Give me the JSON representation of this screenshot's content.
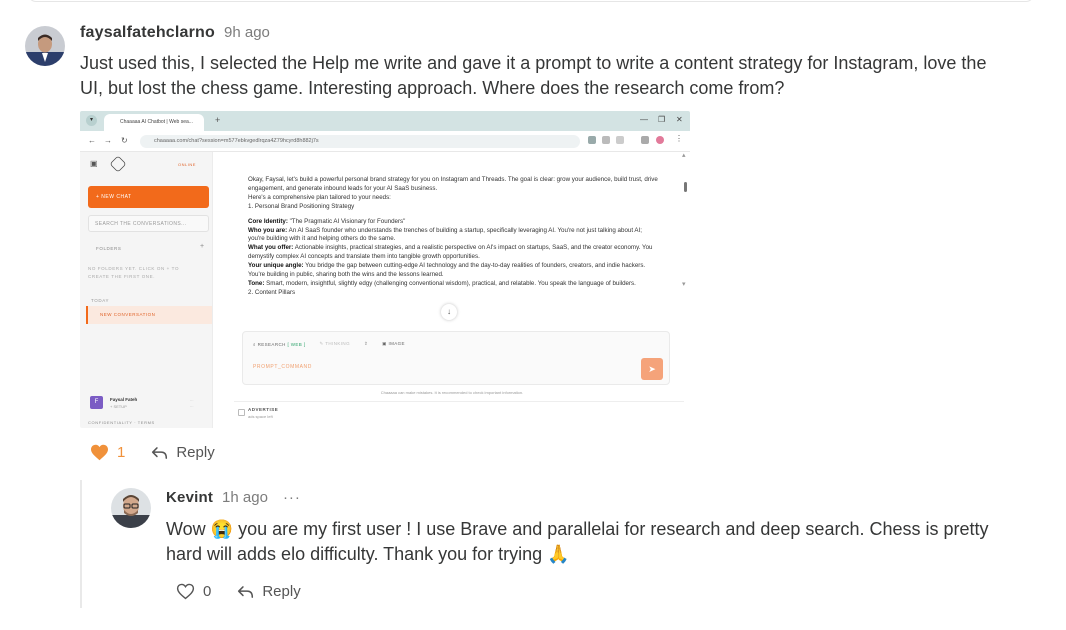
{
  "comment1": {
    "author": "faysalfatehclarno",
    "time": "9h ago",
    "text_line1": "Just used this, I selected the Help me write and gave it a prompt to write a content strategy for Instagram, love the",
    "text_line2": "UI, but lost the chess game. Interesting approach. Where does the research come from?",
    "like_count": "1",
    "reply_label": "Reply"
  },
  "attachment": {
    "tab_title": "Chaaaaa AI Chatbot | Web sea...",
    "url": "chaaaaa.com/chat?session=m577ebkvgedlrqza4Z79hcyrd8h882j7s",
    "sidebar": {
      "online": "ONLINE",
      "new_chat": "+  NEW CHAT",
      "search_placeholder": "SEARCH THE CONVERSATIONS...",
      "folders": "FOLDERS",
      "no_folders": "NO FOLDERS YET. CLICK ON + TO CREATE THE FIRST ONE.",
      "today": "TODAY",
      "new_conversation": "NEW CONVERSATION",
      "user_initial": "F",
      "user_name": "Faysal Fateh",
      "user_tag": "+ SETUP",
      "confidentiality": "CONFIDENTIALITY · TERMS"
    },
    "chat": {
      "p1": "Okay, Faysal, let's build a powerful personal brand strategy for you on Instagram and Threads. The goal is clear: grow your audience, build trust, drive engagement, and generate inbound leads for your AI SaaS business.",
      "p2": "Here's a comprehensive plan tailored to your needs:",
      "p3": "1. Personal Brand Positioning Strategy",
      "core_label": "Core Identity:",
      "core_text": " \"The Pragmatic AI Visionary for Founders\"",
      "who_label": "Who you are:",
      "who_text": " An AI SaaS founder who understands the trenches of building a startup, specifically leveraging AI. You're not just talking about AI; you're building with it and helping others do the same.",
      "what_label": "What you offer:",
      "what_text": " Actionable insights, practical strategies, and a realistic perspective on AI's impact on startups, SaaS, and the creator economy. You demystify complex AI concepts and translate them into tangible growth opportunities.",
      "angle_label": "Your unique angle:",
      "angle_text": " You bridge the gap between cutting-edge AI technology and the day-to-day realities of founders, creators, and indie hackers. You're building in public, sharing both the wins and the lessons learned.",
      "tone_label": "Tone:",
      "tone_text": " Smart, modern, insightful, slightly edgy (challenging conventional wisdom), practical, and relatable. You speak the language of builders.",
      "p_cut": "2. Content Pillars",
      "tool_research": "RESEARCH",
      "tool_research_tag": "[ WEB ]",
      "tool_thinking": "THINKING",
      "tool_image": "IMAGE",
      "prompt_placeholder": "PROMPT_COMMAND",
      "mistakes": "Chaaaaa can make mistakes. It is recommended to check important information.",
      "advert_title": "ADVERTISE",
      "advert_sub": "ads space left"
    }
  },
  "comment2": {
    "author": "Kevint",
    "time": "1h ago",
    "more": "···",
    "text_line1_a": "Wow",
    "emoji1": "😭",
    "text_line1_b": "you are my first user ! I use Brave and parallelai for research and deep search. Chess is pretty",
    "text_line2": "hard will adds elo difficulty. Thank you for trying",
    "emoji2": "🙏",
    "like_count": "0",
    "reply_label": "Reply"
  },
  "colors": {
    "accent_orange": "#f0913a",
    "text": "#363737",
    "muted": "#7c7c7c"
  }
}
